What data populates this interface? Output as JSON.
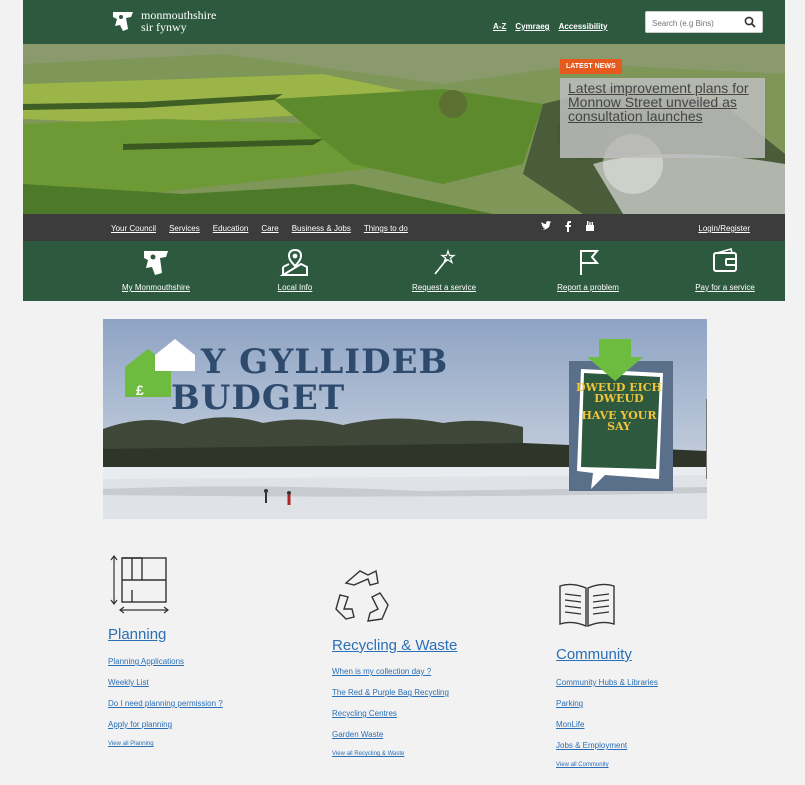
{
  "header": {
    "logo_line1": "monmouthshire",
    "logo_line2": "sir fynwy",
    "links": [
      "A-Z",
      "Cymraeg",
      "Accessibility"
    ],
    "search_placeholder": "Search (e.g Bins)"
  },
  "hero": {
    "badge": "LATEST NEWS",
    "headline": "Latest improvement plans for Monnow Street unveiled as consultation launches"
  },
  "nav": {
    "links": [
      "Your Council",
      "Services",
      "Education",
      "Care",
      "Business & Jobs",
      "Things to do"
    ],
    "social": [
      "twitter-icon",
      "facebook-icon",
      "youtube-icon"
    ],
    "login": "Login/Register"
  },
  "quicklinks": [
    {
      "label": "My Monmouthshire",
      "icon": "monmouthshire-logo-icon"
    },
    {
      "label": "Local Info",
      "icon": "map-pin-icon"
    },
    {
      "label": "Request a service",
      "icon": "magic-wand-icon"
    },
    {
      "label": "Report a problem",
      "icon": "flag-icon"
    },
    {
      "label": "Pay for a service",
      "icon": "wallet-icon"
    }
  ],
  "banner": {
    "title_line1": "Y GYLLIDEB",
    "title_line2": "BUDGET",
    "say_welsh": "DWEUD EICH DWEUD",
    "say_english": "HAVE YOUR SAY",
    "pound_sign": "£"
  },
  "columns": [
    {
      "title": "Planning",
      "icon": "floorplan-icon",
      "links": [
        "Planning Applications",
        "Weekly List",
        "Do I need planning permission ?",
        "Apply for planning"
      ],
      "view_all": "View all Planning"
    },
    {
      "title": "Recycling & Waste",
      "icon": "recycle-icon",
      "links": [
        "When is my collection day ?",
        "The Red & Purple Bag Recycling",
        "Recycling Centres",
        "Garden Waste"
      ],
      "view_all": "View all Recycling & Waste"
    },
    {
      "title": "Community",
      "icon": "open-book-icon",
      "links": [
        "Community Hubs & Libraries",
        "Parking",
        "MonLife",
        "Jobs & Employment"
      ],
      "view_all": "View all Community"
    }
  ],
  "colors": {
    "brand_green": "#2d5a3f",
    "nav_dark": "#3c3c3c",
    "news_orange": "#e65a1e",
    "link_blue": "#2b6fb6"
  }
}
